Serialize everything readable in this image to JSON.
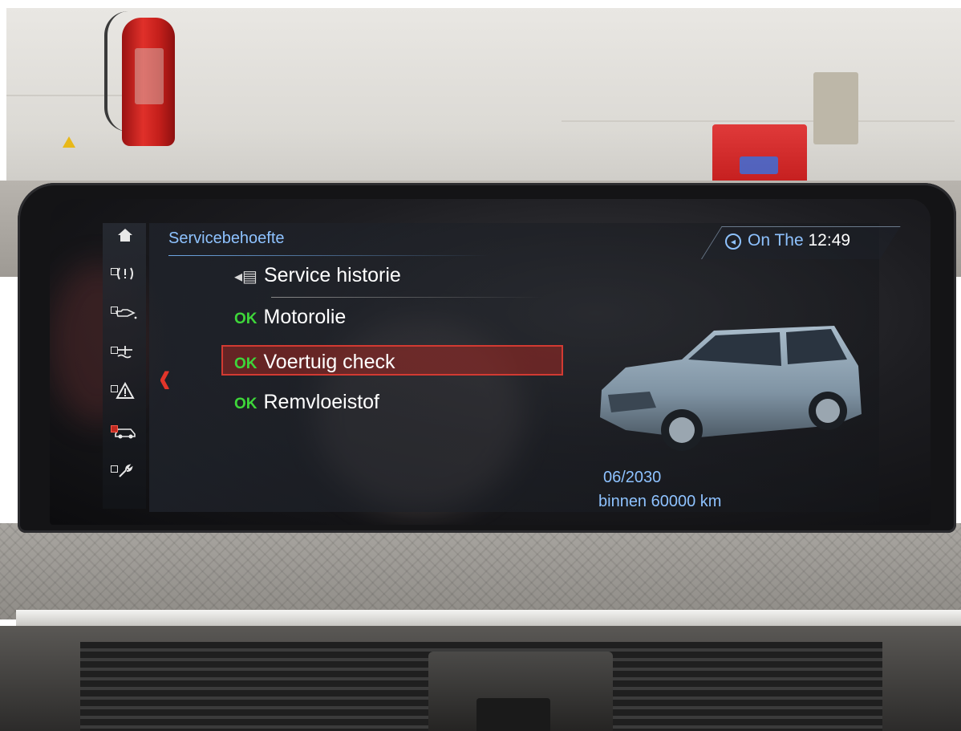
{
  "screen": {
    "title": "Servicebehoefte",
    "status": {
      "day": "On The",
      "time": "12:49",
      "icon": "clock-icon"
    },
    "menu": [
      {
        "prefix": "",
        "icon": "service-history-icon",
        "label": "Service historie"
      },
      {
        "prefix": "OK",
        "label": "Motorolie"
      },
      {
        "prefix": "OK",
        "label": "Voertuig check",
        "selected": true
      },
      {
        "prefix": "OK",
        "label": "Remvloeistof"
      }
    ],
    "detail": {
      "date": "06/2030",
      "distance": "binnen 60000 km"
    },
    "rail_icons": [
      "home-icon",
      "tire-pressure-icon",
      "oil-icon",
      "coolant-icon",
      "warning-triangle-icon",
      "car-service-icon",
      "wrench-service-icon"
    ],
    "colors": {
      "accent": "#8ec2ff",
      "ok": "#3ed63a",
      "selection": "#d23a32"
    }
  }
}
